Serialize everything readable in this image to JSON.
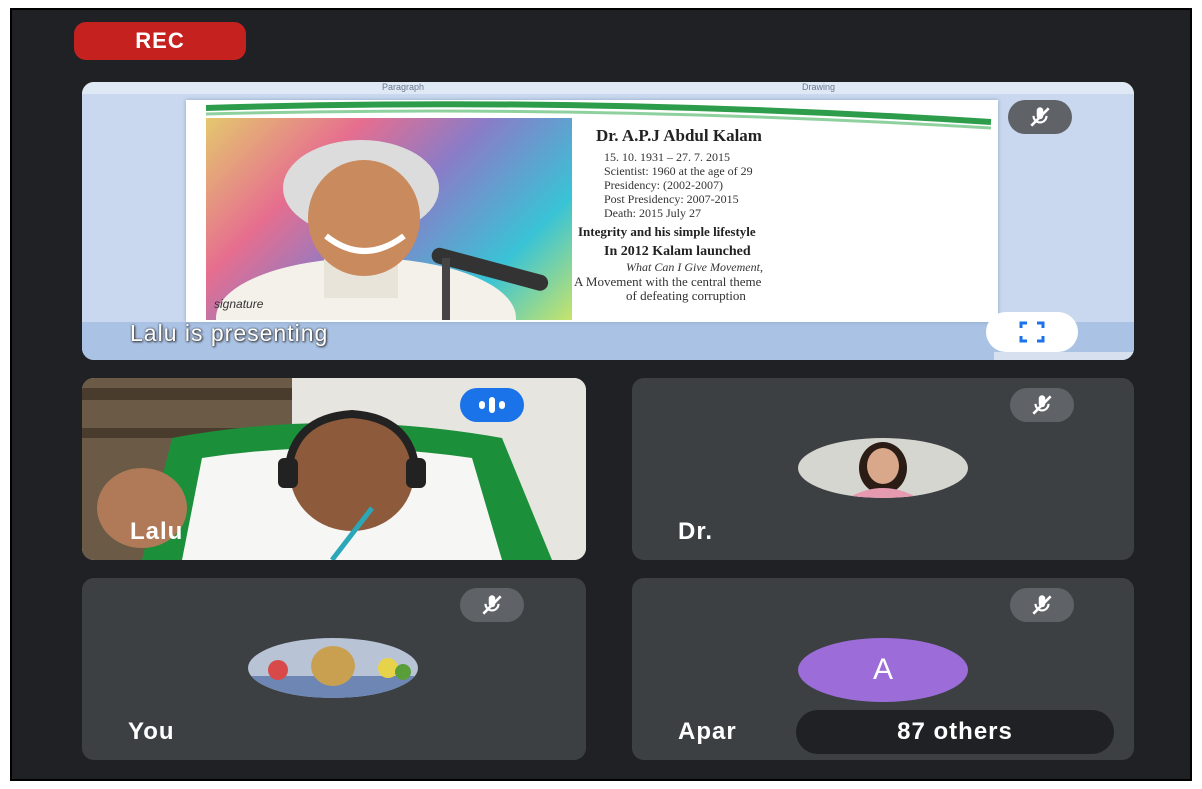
{
  "recording": {
    "label": "REC"
  },
  "presentation": {
    "ribbon": [
      "Paragraph",
      "Drawing"
    ],
    "slide": {
      "title": "Dr. A.P.J Abdul Kalam",
      "lines": [
        "15. 10. 1931 – 27. 7. 2015",
        "Scientist: 1960 at the age of 29",
        "Presidency:  (2002-2007)",
        "Post Presidency:  2007-2015",
        "Death:  2015 July 27"
      ],
      "bold_line_1": "Integrity and his simple lifestyle",
      "bold_line_2": "In 2012 Kalam launched",
      "italic_line": "What Can I Give Movement",
      "italic_suffix": ",",
      "line_a": "A Movement  with the central theme",
      "line_b": "of defeating corruption"
    },
    "presenting_label": "Lalu is presenting"
  },
  "participants": [
    {
      "name": "Lalu",
      "speaking": true
    },
    {
      "name": "Dr.",
      "muted": true
    },
    {
      "name": "You",
      "muted": true
    },
    {
      "name": "Apar",
      "muted": true,
      "avatar_letter": "A",
      "avatar_color": "#9c6dd9"
    }
  ],
  "others": {
    "label": "87 others"
  },
  "colors": {
    "background": "#202124",
    "tile": "#3c4043",
    "rec": "#c5221f",
    "speaking": "#1a73e8"
  }
}
